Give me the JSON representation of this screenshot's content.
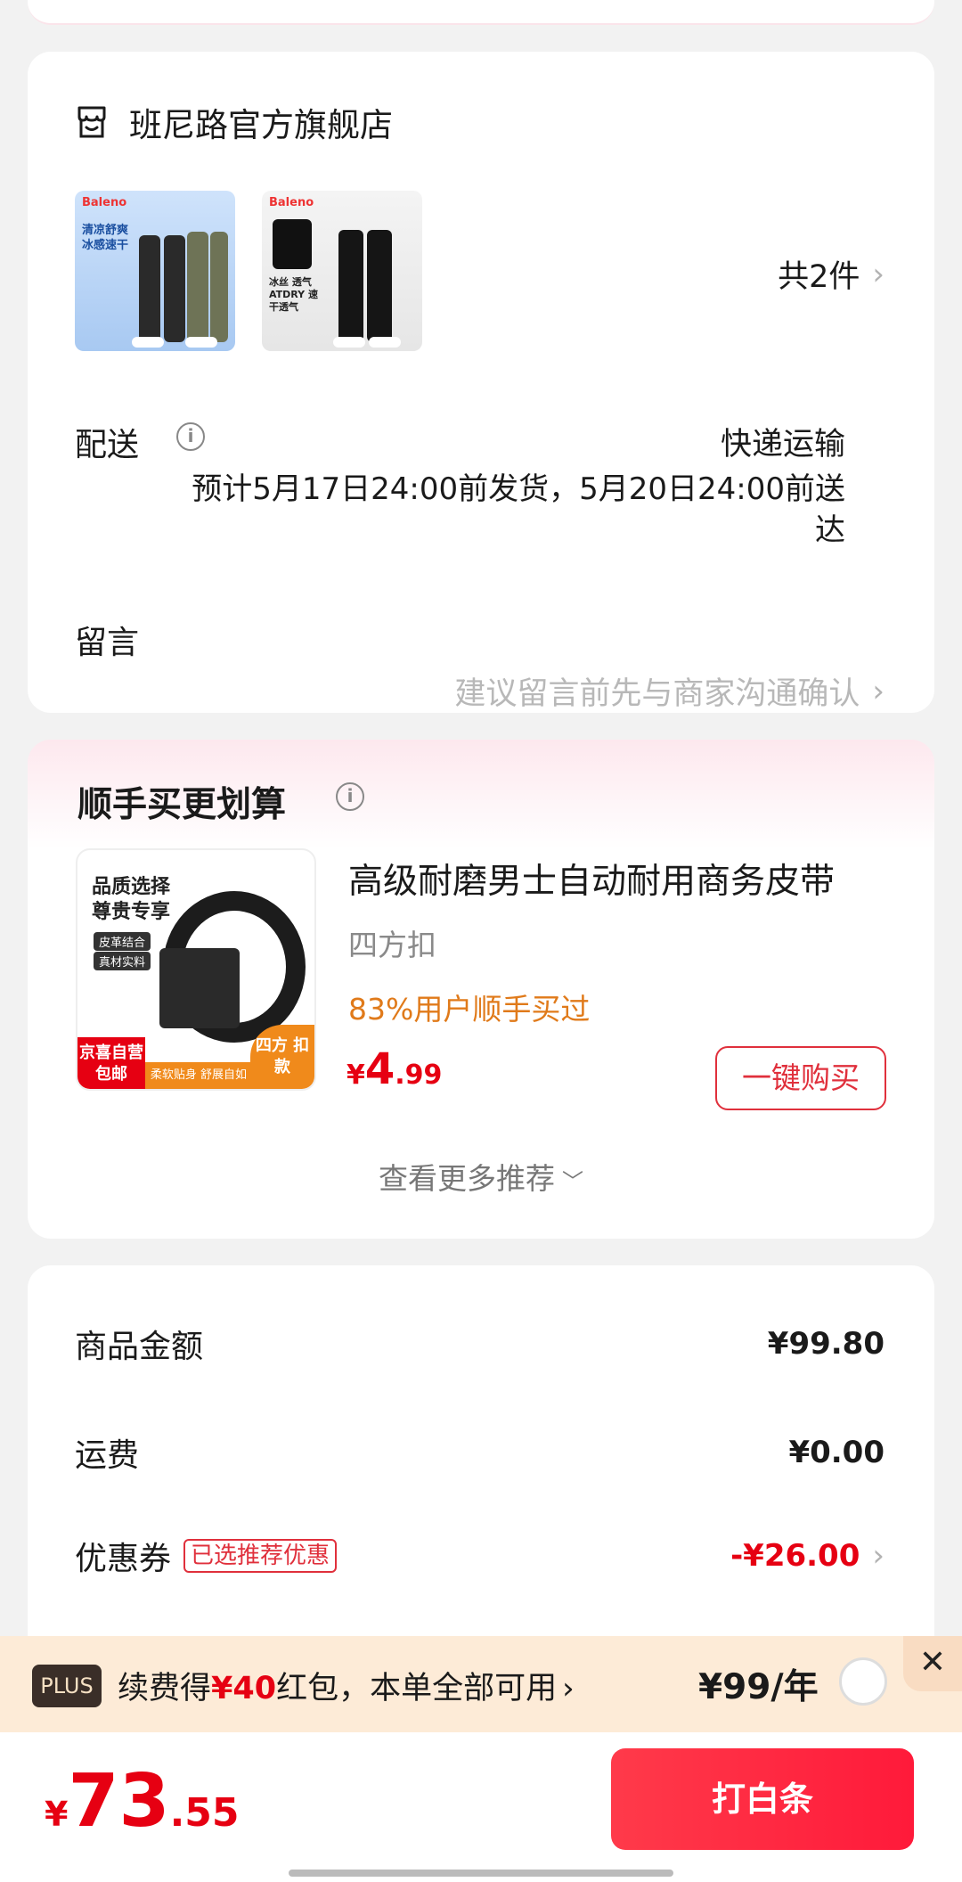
{
  "store": {
    "name": "班尼路官方旗舰店",
    "product_thumb_1": {
      "brand": "Baleno",
      "tagline": "清凉舒爽 冰感速干"
    },
    "product_thumb_2": {
      "brand": "Baleno",
      "tagline": "冰丝 透气 ATDRY 速干透气"
    },
    "item_count": "共2件",
    "delivery": {
      "label": "配送",
      "method": "快递运输",
      "eta": "预计5月17日24:00前发货，5月20日24:00前送达"
    },
    "note": {
      "label": "留言",
      "placeholder": "建议留言前先与商家沟通确认"
    }
  },
  "recommendation": {
    "title": "顺手买更划算",
    "product": {
      "name": "高级耐磨男士自动耐用商务皮带",
      "variant": "四方扣",
      "social_proof": "83%用户顺手买过",
      "price_currency": "¥",
      "price_int": "4",
      "price_dec": ".99",
      "buy_label": "一键购买",
      "image_text": {
        "headline": "品质选择 尊贵专享",
        "pill1": "皮革结合",
        "pill2": "真材实料",
        "redtag": "京喜自营 包邮",
        "bar": "柔软贴身 舒展自如",
        "corner": "四方 扣款"
      }
    },
    "more_label": "查看更多推荐"
  },
  "summary": {
    "goods_label": "商品金额",
    "goods_value": "¥99.80",
    "shipping_label": "运费",
    "shipping_value": "¥0.00",
    "coupon_label": "优惠券",
    "coupon_badge": "已选推荐优惠",
    "coupon_value": "-¥26.00"
  },
  "plus": {
    "badge": "PLUS",
    "text_pre": "续费得",
    "text_amount": "¥40",
    "text_post": "红包，本单全部可用",
    "price": "¥99/年",
    "close": "✕"
  },
  "bottom": {
    "currency": "¥",
    "total_int": "73",
    "total_dec": ".55",
    "pay_label": "打白条"
  },
  "colors": {
    "accent_red": "#e60012",
    "social_orange": "#e07a1a",
    "plus_bg": "#fdebd7"
  }
}
